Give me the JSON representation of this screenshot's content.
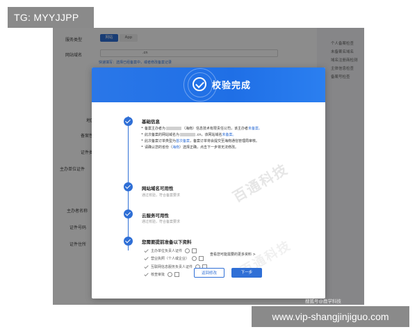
{
  "tag": "TG: MYYJJPP",
  "url": "www.vip-shangjinjiguo.com",
  "background_form": {
    "service_type_label": "服务类型",
    "service_type_options": [
      "网站",
      "App"
    ],
    "domain_label": "网站域名",
    "domain_suffix": ".cn",
    "tip": "快速填写：选择已经备案中，或者修改备案记录",
    "region_label": "地区",
    "nature_label": "备案性质",
    "cert_type_label": "证件类型",
    "host_cert_label": "主办单位证件",
    "host_name_label": "主办者名称",
    "cert_no_label": "证件号码",
    "cert_addr_label": "证件住所",
    "right_panel": [
      "个人备案检查",
      "未备案名域名",
      "域名注册商检测",
      "主体信息检查",
      "备案号检查"
    ]
  },
  "dialog": {
    "title": "校验完成",
    "steps": [
      {
        "title": "基础信息",
        "bullets": [
          {
            "pre": "备案主办者为",
            "post": "（海南）信息技术有限责任公司，该主办者",
            "hl": "未备案。"
          },
          {
            "pre": "此次备案的网站域名为",
            "post": ".cn，该网站域名",
            "hl": "未备案。"
          },
          {
            "pre": "此次备案订单类型为",
            "hl": "首次备案",
            "post": "，备案订单将会提交至海南通信管理局审核。"
          },
          {
            "pre": "请确认您的省份（",
            "hl": "海南",
            "post": "）选择正确，点击下一步将无法修改。"
          }
        ]
      },
      {
        "title": "网站域名可用性",
        "desc": "通过校验，符合备案要求"
      },
      {
        "title": "云服务可用性",
        "desc": "通过校验，符合备案要求"
      },
      {
        "title": "您需要提前准备以下资料",
        "materials": [
          "主办单位负责人证件",
          "营业执照（个人或企业）",
          "互联网信息服务负责人证件",
          "核查审批"
        ]
      }
    ],
    "more_link": "查看您可能需要的更多资料 >",
    "back_button": "返回修改",
    "next_button": "下一步"
  },
  "watermark": "百通科技",
  "credit": "搜狐号@鹿学科技"
}
